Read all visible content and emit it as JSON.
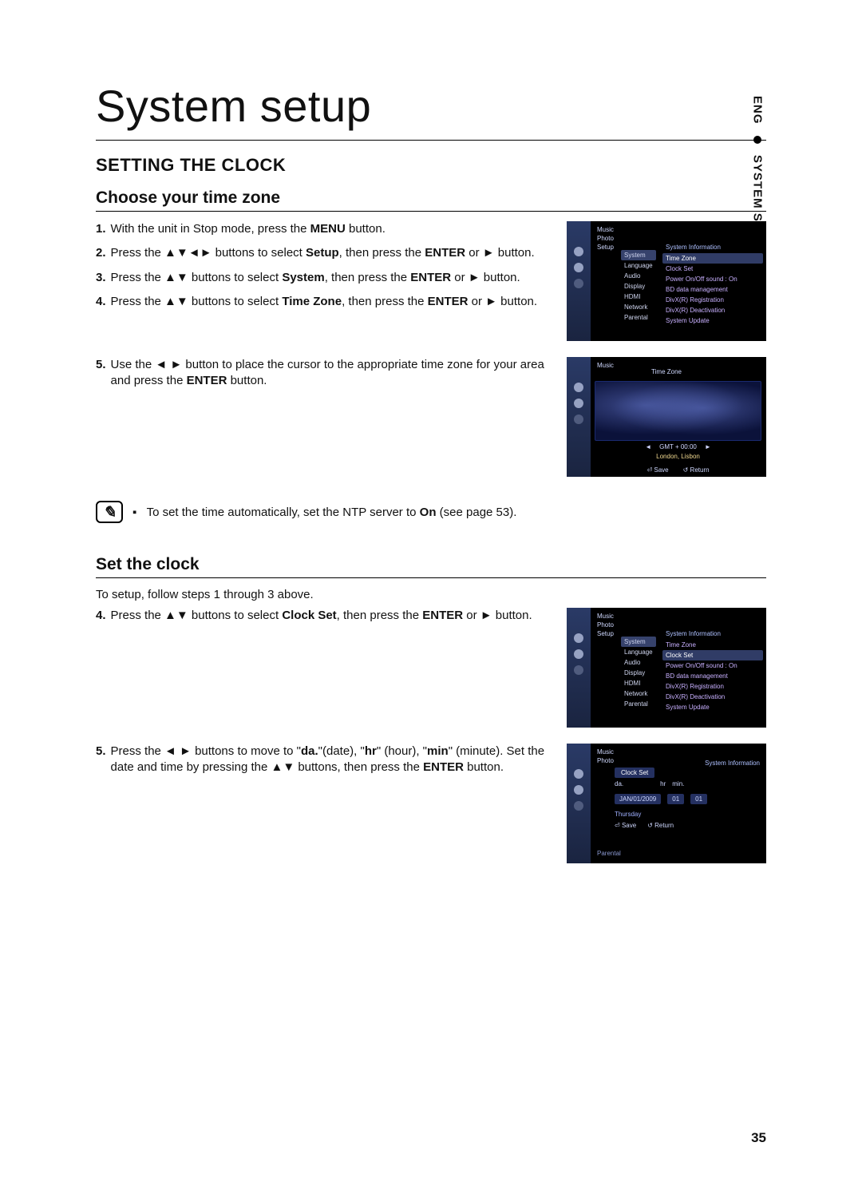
{
  "page": {
    "lang": "ENG",
    "section": "SYSTEM SETUP",
    "title": "System setup",
    "heading": "SETTING THE CLOCK",
    "page_number": "35"
  },
  "choose_tz": {
    "heading": "Choose your time zone",
    "steps": [
      {
        "n": "1.",
        "pre": "With the unit in Stop mode, press the ",
        "bold": "MENU",
        "post": " button."
      },
      {
        "n": "2.",
        "pre": "Press the ▲▼◄► buttons to select ",
        "bold": "Setup",
        "post": ", then press the ",
        "bold2": "ENTER",
        "post2": " or ► button."
      },
      {
        "n": "3.",
        "pre": "Press the ▲▼ buttons to select ",
        "bold": "System",
        "post": ", then press the ",
        "bold2": "ENTER",
        "post2": " or ► button."
      },
      {
        "n": "4.",
        "pre": "Press the ▲▼ buttons to select ",
        "bold": "Time Zone",
        "post": ", then press the ",
        "bold2": "ENTER",
        "post2": " or ► button."
      },
      {
        "n": "5.",
        "pre": "Use the ◄ ► button to place the cursor to the appropriate time zone for your area and press the ",
        "bold": "ENTER",
        "post": " button."
      }
    ]
  },
  "note": {
    "bullet": "▪",
    "text_pre": "To set the time automatically, set the NTP server to ",
    "bold": "On",
    "text_post": " (see page 53)."
  },
  "set_clock": {
    "heading": "Set the clock",
    "intro": "To setup, follow steps 1 through 3 above.",
    "steps": [
      {
        "n": "4.",
        "pre": "Press the ▲▼ buttons to select ",
        "bold": "Clock Set",
        "post": ", then press the ",
        "bold2": "ENTER",
        "post2": " or ► button."
      },
      {
        "n": "5.",
        "pre": "Press the ◄ ► buttons to move to \"",
        "bold": "da.",
        "mid1": "\"(date), \"",
        "bold2": "hr",
        "mid2": "\" (hour), \"",
        "bold3": "min",
        "mid3": "\" (minute). Set the date and time by pressing the ▲▼ buttons, then press the ",
        "bold4": "ENTER",
        "post": " button."
      }
    ]
  },
  "tv": {
    "nav_top": [
      "Music",
      "Photo"
    ],
    "setup_label": "Setup",
    "menu_col": [
      "System",
      "Language",
      "Audio",
      "Display",
      "HDMI",
      "Network",
      "Parental"
    ],
    "panel1_header": "System Information",
    "panel1_items": [
      "Time Zone",
      "Clock Set",
      "Power On/Off sound   :   On",
      "BD data management",
      "DivX(R) Registration",
      "DivX(R) Deactivation",
      "System Update"
    ],
    "panel3_header": "System Information",
    "panel3_items": [
      "Time Zone",
      "Clock Set",
      "Power On/Off sound   :   On",
      "BD data management",
      "DivX(R) Registration",
      "DivX(R) Deactivation",
      "System Update"
    ],
    "tz_title": "Time Zone",
    "gmt": "GMT + 00:00",
    "cities": "London, Lisbon",
    "save": "Save",
    "return": "Return",
    "clockset": {
      "title": "Clock Set",
      "labels": {
        "da": "da.",
        "hr": "hr",
        "min": "min."
      },
      "date": "JAN/01/2009",
      "hr": "01",
      "min": "01",
      "weekday": "Thursday"
    }
  }
}
